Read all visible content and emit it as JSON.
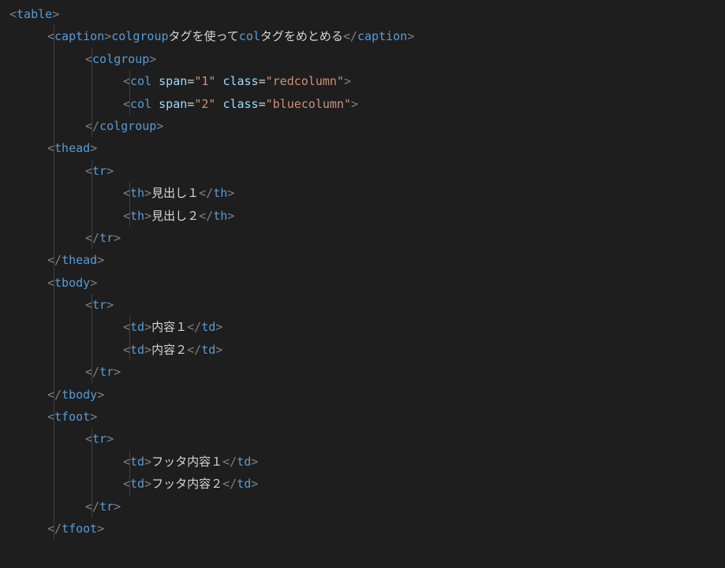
{
  "code": {
    "lines": [
      {
        "indent": 0,
        "guides": [],
        "tokens": [
          {
            "t": "bracket",
            "v": "<"
          },
          {
            "t": "tag",
            "v": "table"
          },
          {
            "t": "bracket",
            "v": ">"
          }
        ]
      },
      {
        "indent": 1,
        "guides": [
          1
        ],
        "tokens": [
          {
            "t": "bracket",
            "v": "<"
          },
          {
            "t": "tag",
            "v": "caption"
          },
          {
            "t": "bracket",
            "v": ">"
          },
          {
            "t": "tag",
            "v": "colgroup"
          },
          {
            "t": "text",
            "v": "タグを使って"
          },
          {
            "t": "tag",
            "v": "col"
          },
          {
            "t": "text",
            "v": "タグをめとめる"
          },
          {
            "t": "bracket",
            "v": "</"
          },
          {
            "t": "tag",
            "v": "caption"
          },
          {
            "t": "bracket",
            "v": ">"
          }
        ]
      },
      {
        "indent": 2,
        "guides": [
          1,
          2
        ],
        "tokens": [
          {
            "t": "bracket",
            "v": "<"
          },
          {
            "t": "tag",
            "v": "colgroup"
          },
          {
            "t": "bracket",
            "v": ">"
          }
        ]
      },
      {
        "indent": 3,
        "guides": [
          1,
          2,
          3
        ],
        "tokens": [
          {
            "t": "bracket",
            "v": "<"
          },
          {
            "t": "tag",
            "v": "col"
          },
          {
            "t": "text",
            "v": " "
          },
          {
            "t": "attr-name",
            "v": "span"
          },
          {
            "t": "text",
            "v": "="
          },
          {
            "t": "attr-value",
            "v": "\"1\""
          },
          {
            "t": "text",
            "v": " "
          },
          {
            "t": "attr-name",
            "v": "class"
          },
          {
            "t": "text",
            "v": "="
          },
          {
            "t": "attr-value",
            "v": "\"redcolumn\""
          },
          {
            "t": "bracket",
            "v": ">"
          }
        ]
      },
      {
        "indent": 3,
        "guides": [
          1,
          2,
          3
        ],
        "tokens": [
          {
            "t": "bracket",
            "v": "<"
          },
          {
            "t": "tag",
            "v": "col"
          },
          {
            "t": "text",
            "v": " "
          },
          {
            "t": "attr-name",
            "v": "span"
          },
          {
            "t": "text",
            "v": "="
          },
          {
            "t": "attr-value",
            "v": "\"2\""
          },
          {
            "t": "text",
            "v": " "
          },
          {
            "t": "attr-name",
            "v": "class"
          },
          {
            "t": "text",
            "v": "="
          },
          {
            "t": "attr-value",
            "v": "\"bluecolumn\""
          },
          {
            "t": "bracket",
            "v": ">"
          }
        ]
      },
      {
        "indent": 2,
        "guides": [
          1,
          2
        ],
        "tokens": [
          {
            "t": "bracket",
            "v": "</"
          },
          {
            "t": "tag",
            "v": "colgroup"
          },
          {
            "t": "bracket",
            "v": ">"
          }
        ]
      },
      {
        "indent": 1,
        "guides": [
          1
        ],
        "tokens": [
          {
            "t": "bracket",
            "v": "<"
          },
          {
            "t": "tag",
            "v": "thead"
          },
          {
            "t": "bracket",
            "v": ">"
          }
        ]
      },
      {
        "indent": 2,
        "guides": [
          1,
          2
        ],
        "tokens": [
          {
            "t": "bracket",
            "v": "<"
          },
          {
            "t": "tag",
            "v": "tr"
          },
          {
            "t": "bracket",
            "v": ">"
          }
        ]
      },
      {
        "indent": 3,
        "guides": [
          1,
          2,
          3
        ],
        "tokens": [
          {
            "t": "bracket",
            "v": "<"
          },
          {
            "t": "tag",
            "v": "th"
          },
          {
            "t": "bracket",
            "v": ">"
          },
          {
            "t": "text",
            "v": "見出し１"
          },
          {
            "t": "bracket",
            "v": "</"
          },
          {
            "t": "tag",
            "v": "th"
          },
          {
            "t": "bracket",
            "v": ">"
          }
        ]
      },
      {
        "indent": 3,
        "guides": [
          1,
          2,
          3
        ],
        "tokens": [
          {
            "t": "bracket",
            "v": "<"
          },
          {
            "t": "tag",
            "v": "th"
          },
          {
            "t": "bracket",
            "v": ">"
          },
          {
            "t": "text",
            "v": "見出し２"
          },
          {
            "t": "bracket",
            "v": "</"
          },
          {
            "t": "tag",
            "v": "th"
          },
          {
            "t": "bracket",
            "v": ">"
          }
        ]
      },
      {
        "indent": 2,
        "guides": [
          1,
          2
        ],
        "tokens": [
          {
            "t": "bracket",
            "v": "</"
          },
          {
            "t": "tag",
            "v": "tr"
          },
          {
            "t": "bracket",
            "v": ">"
          }
        ]
      },
      {
        "indent": 1,
        "guides": [
          1
        ],
        "tokens": [
          {
            "t": "bracket",
            "v": "</"
          },
          {
            "t": "tag",
            "v": "thead"
          },
          {
            "t": "bracket",
            "v": ">"
          }
        ]
      },
      {
        "indent": 1,
        "guides": [
          1
        ],
        "tokens": [
          {
            "t": "bracket",
            "v": "<"
          },
          {
            "t": "tag",
            "v": "tbody"
          },
          {
            "t": "bracket",
            "v": ">"
          }
        ]
      },
      {
        "indent": 2,
        "guides": [
          1,
          2
        ],
        "tokens": [
          {
            "t": "bracket",
            "v": "<"
          },
          {
            "t": "tag",
            "v": "tr"
          },
          {
            "t": "bracket",
            "v": ">"
          }
        ]
      },
      {
        "indent": 3,
        "guides": [
          1,
          2,
          3
        ],
        "tokens": [
          {
            "t": "bracket",
            "v": "<"
          },
          {
            "t": "tag",
            "v": "td"
          },
          {
            "t": "bracket",
            "v": ">"
          },
          {
            "t": "text",
            "v": "内容１"
          },
          {
            "t": "bracket",
            "v": "</"
          },
          {
            "t": "tag",
            "v": "td"
          },
          {
            "t": "bracket",
            "v": ">"
          }
        ]
      },
      {
        "indent": 3,
        "guides": [
          1,
          2,
          3
        ],
        "tokens": [
          {
            "t": "bracket",
            "v": "<"
          },
          {
            "t": "tag",
            "v": "td"
          },
          {
            "t": "bracket",
            "v": ">"
          },
          {
            "t": "text",
            "v": "内容２"
          },
          {
            "t": "bracket",
            "v": "</"
          },
          {
            "t": "tag",
            "v": "td"
          },
          {
            "t": "bracket",
            "v": ">"
          }
        ]
      },
      {
        "indent": 2,
        "guides": [
          1,
          2
        ],
        "tokens": [
          {
            "t": "bracket",
            "v": "</"
          },
          {
            "t": "tag",
            "v": "tr"
          },
          {
            "t": "bracket",
            "v": ">"
          }
        ]
      },
      {
        "indent": 1,
        "guides": [
          1
        ],
        "tokens": [
          {
            "t": "bracket",
            "v": "</"
          },
          {
            "t": "tag",
            "v": "tbody"
          },
          {
            "t": "bracket",
            "v": ">"
          }
        ]
      },
      {
        "indent": 1,
        "guides": [
          1
        ],
        "tokens": [
          {
            "t": "bracket",
            "v": "<"
          },
          {
            "t": "tag",
            "v": "tfoot"
          },
          {
            "t": "bracket",
            "v": ">"
          }
        ]
      },
      {
        "indent": 2,
        "guides": [
          1,
          2
        ],
        "tokens": [
          {
            "t": "bracket",
            "v": "<"
          },
          {
            "t": "tag",
            "v": "tr"
          },
          {
            "t": "bracket",
            "v": ">"
          }
        ]
      },
      {
        "indent": 3,
        "guides": [
          1,
          2,
          3
        ],
        "tokens": [
          {
            "t": "bracket",
            "v": "<"
          },
          {
            "t": "tag",
            "v": "td"
          },
          {
            "t": "bracket",
            "v": ">"
          },
          {
            "t": "text",
            "v": "フッタ内容１"
          },
          {
            "t": "bracket",
            "v": "</"
          },
          {
            "t": "tag",
            "v": "td"
          },
          {
            "t": "bracket",
            "v": ">"
          }
        ]
      },
      {
        "indent": 3,
        "guides": [
          1,
          2,
          3
        ],
        "tokens": [
          {
            "t": "bracket",
            "v": "<"
          },
          {
            "t": "tag",
            "v": "td"
          },
          {
            "t": "bracket",
            "v": ">"
          },
          {
            "t": "text",
            "v": "フッタ内容２"
          },
          {
            "t": "bracket",
            "v": "</"
          },
          {
            "t": "tag",
            "v": "td"
          },
          {
            "t": "bracket",
            "v": ">"
          }
        ]
      },
      {
        "indent": 2,
        "guides": [
          1,
          2
        ],
        "tokens": [
          {
            "t": "bracket",
            "v": "</"
          },
          {
            "t": "tag",
            "v": "tr"
          },
          {
            "t": "bracket",
            "v": ">"
          }
        ]
      },
      {
        "indent": 1,
        "guides": [
          1
        ],
        "tokens": [
          {
            "t": "bracket",
            "v": "</"
          },
          {
            "t": "tag",
            "v": "tfoot"
          },
          {
            "t": "bracket",
            "v": ">"
          }
        ]
      }
    ]
  }
}
